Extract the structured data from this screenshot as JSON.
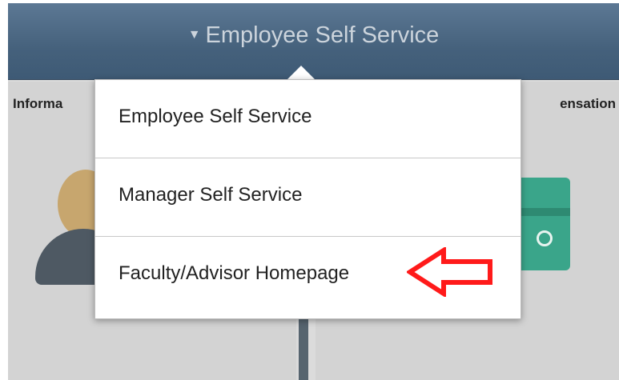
{
  "header": {
    "title": "Employee Self Service",
    "caret_glyph": "▼"
  },
  "tiles": [
    {
      "title": "Informa",
      "icon": "person-icon"
    },
    {
      "title": "ensation",
      "icon": "money-icon"
    }
  ],
  "menu": {
    "items": [
      {
        "label": "Employee Self Service"
      },
      {
        "label": "Manager Self Service"
      },
      {
        "label": "Faculty/Advisor Homepage"
      }
    ]
  },
  "annotation": {
    "icon": "red-arrow-icon",
    "color": "#ff1a1a"
  },
  "colors": {
    "header": "#45617c",
    "menu_bg": "#ffffff",
    "tile_bg": "#d3d3d3"
  }
}
